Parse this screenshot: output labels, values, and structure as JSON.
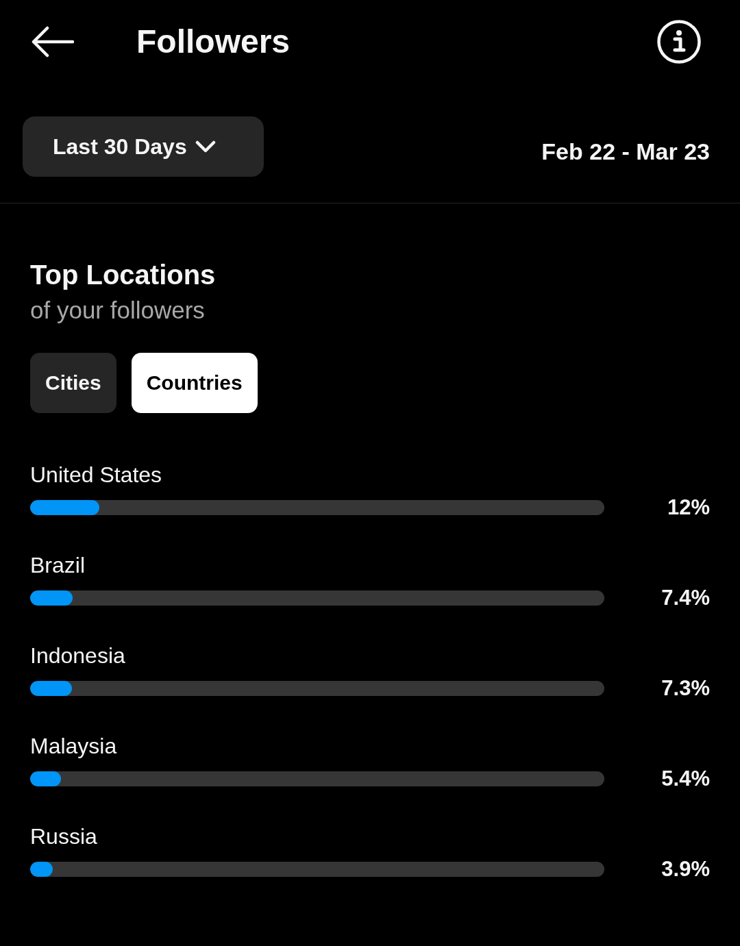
{
  "header": {
    "title": "Followers"
  },
  "period": {
    "label": "Last 30 Days",
    "range": "Feb 22 - Mar 23"
  },
  "section": {
    "title": "Top Locations",
    "subtitle": "of your followers"
  },
  "tabs": [
    {
      "label": "Cities",
      "selected": false
    },
    {
      "label": "Countries",
      "selected": true
    }
  ],
  "locations": [
    {
      "name": "United States",
      "level": 0.12,
      "reading": "12%"
    },
    {
      "name": "Brazil",
      "level": 0.074,
      "reading": "7.4%"
    },
    {
      "name": "Indonesia",
      "level": 0.073,
      "reading": "7.3%"
    },
    {
      "name": "Malaysia",
      "level": 0.054,
      "reading": "5.4%"
    },
    {
      "name": "Russia",
      "level": 0.039,
      "reading": "3.9%"
    }
  ]
}
